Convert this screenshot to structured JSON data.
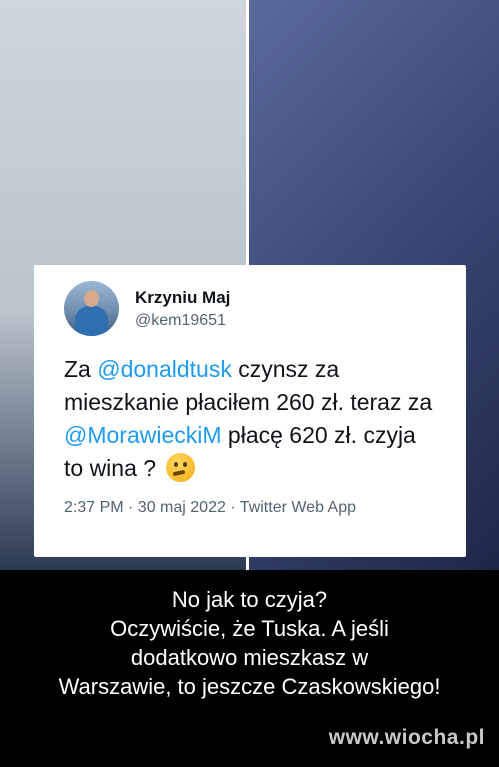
{
  "tweet": {
    "display_name": "Krzyniu Maj",
    "handle": "@kem19651",
    "text_1": "Za ",
    "mention_1": "@donaldtusk",
    "text_2": " czynsz za mieszkanie płaciłem 260 zł. teraz za ",
    "mention_2": "@MorawieckiM",
    "text_3": "  płacę 620 zł. czyja to wina ?",
    "emoji_icon": "thinking-face-icon",
    "timestamp": "2:37 PM · 30 maj 2022 · Twitter Web App"
  },
  "caption": {
    "line_1": "No jak to czyja?",
    "line_2": "Oczywiście, że Tuska. A jeśli",
    "line_3": "dodatkowo mieszkasz w",
    "line_4": "Warszawie, to jeszcze Czaskowskiego!"
  },
  "watermark": "www.wiocha.pl",
  "colors": {
    "mention": "#1d9bf0",
    "background": "#000000",
    "caption_text": "#ffffff"
  }
}
